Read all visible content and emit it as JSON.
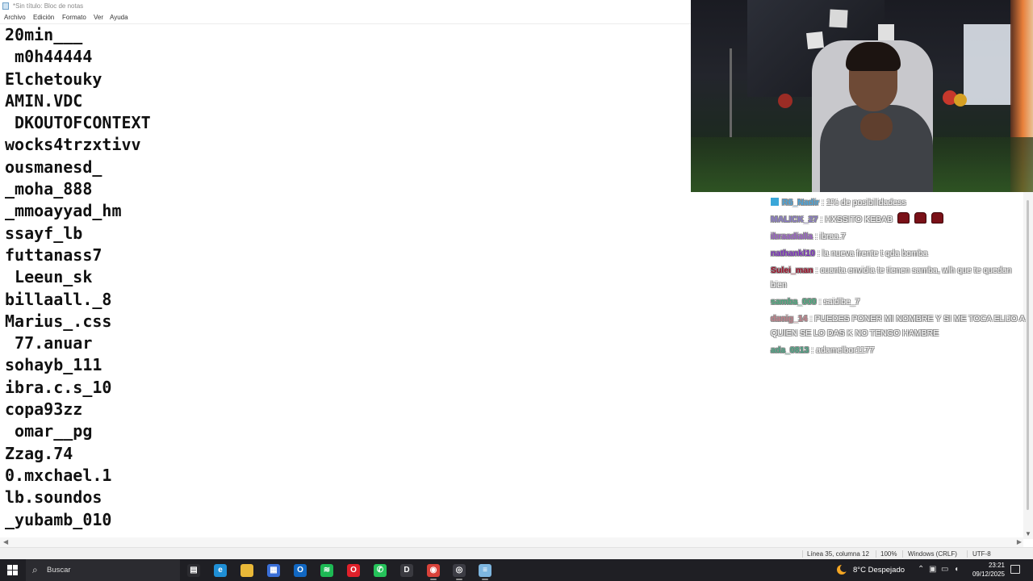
{
  "window": {
    "title": "*Sin título: Bloc de notas"
  },
  "menu": [
    "Archivo",
    "Edición",
    "Formato",
    "Ver",
    "Ayuda"
  ],
  "editor_lines": [
    "20min___",
    " m0h44444",
    "Elchetouky",
    "AMIN.VDC",
    " DKOUTOFCONTEXT",
    "wocks4trzxtivv",
    "ousmanesd_",
    "_moha_888",
    "_mmoayyad_hm",
    "ssayf_lb",
    "futtanass7",
    " Leeun_sk",
    "billaall._8",
    "Marius_.css",
    " 77.anuar",
    "sohayb_111",
    "ibra.c.s_10",
    "copa93zz",
    " omar__pg",
    "Zzag.74",
    "0.mxchael.1",
    "lb.soundos",
    "_yubamb_010"
  ],
  "statusbar": {
    "position": "Línea 35, columna 12",
    "zoom": "100%",
    "line_ending": "Windows (CRLF)",
    "encoding": "UTF-8"
  },
  "chat": [
    {
      "user": "R6_Nadir",
      "color": "#4aa3d8",
      "text": ": 1% de posibilidadess",
      "badge": true
    },
    {
      "user": "MALICK_27",
      "color": "#8a7ac8",
      "text": ": HXSSITO KEBAB",
      "emotes": 3
    },
    {
      "user": "ibraadialla",
      "color": "#9a5fc7",
      "text": ": ibraa.7"
    },
    {
      "user": "nathankl10",
      "color": "#7b2fbf",
      "text": ": la nueva frente t qda bomba"
    },
    {
      "user": "Sulei_man",
      "color": "#a0102a",
      "text": ": cuanta envidia te tienen samba, wlh que te quedan bien"
    },
    {
      "user": "samba_000",
      "color": "#47a67a",
      "text": ": saidibe_7"
    },
    {
      "user": "danig_14",
      "color": "#c2808a",
      "text": ": PUEDES PONER MI NOMBRE Y SI ME TOCA ELIJO A QUIEN SE LO DAS K NO TENGO HAMBRE"
    },
    {
      "user": "ada_0813",
      "color": "#45a07f",
      "text": ": adamelbor1177"
    }
  ],
  "taskbar": {
    "search_label": "Buscar",
    "weather": "8°C  Despejado",
    "time": "23:21",
    "date": "09/12/2025",
    "apps": [
      {
        "name": "task-view-icon",
        "color": "#2b2b30",
        "glyph": "▤"
      },
      {
        "name": "edge-icon",
        "color": "#1f8fd6",
        "glyph": "e"
      },
      {
        "name": "file-explorer-icon",
        "color": "#e9b838",
        "glyph": ""
      },
      {
        "name": "store-icon",
        "color": "#3a6fd8",
        "glyph": "▦"
      },
      {
        "name": "outlook-icon",
        "color": "#1167c2",
        "glyph": "O"
      },
      {
        "name": "spotify-icon",
        "color": "#1db954",
        "glyph": "≋"
      },
      {
        "name": "opera-icon",
        "color": "#e0202a",
        "glyph": "O"
      },
      {
        "name": "whatsapp-icon",
        "color": "#25c35a",
        "glyph": "✆"
      },
      {
        "name": "d-app-icon",
        "color": "#3a3a40",
        "glyph": "D"
      },
      {
        "name": "chrome-icon",
        "color": "#d9423a",
        "glyph": "◉"
      },
      {
        "name": "obs-icon",
        "color": "#3c3c44",
        "glyph": "◎"
      },
      {
        "name": "notepad-icon",
        "color": "#7db6e0",
        "glyph": "≡"
      }
    ]
  }
}
